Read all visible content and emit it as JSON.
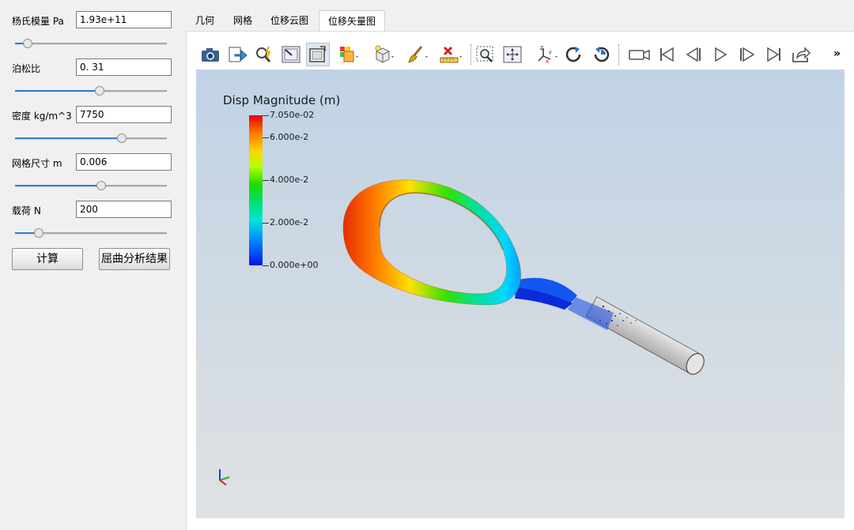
{
  "params": [
    {
      "label": "杨氏模量 Pa",
      "value": "1.93e+11",
      "slider": 0.08
    },
    {
      "label": "泊松比",
      "value": "0. 31",
      "slider": 0.55
    },
    {
      "label": "密度 kg/m^3",
      "value": "7750",
      "slider": 0.7
    },
    {
      "label": "网格尺寸 m",
      "value": "0.006",
      "slider": 0.56
    },
    {
      "label": "载荷 N",
      "value": "200",
      "slider": 0.15
    }
  ],
  "buttons": {
    "compute": "计算",
    "buckling": "屈曲分析结果"
  },
  "tabs": [
    {
      "label": "几何",
      "active": false
    },
    {
      "label": "网格",
      "active": false
    },
    {
      "label": "位移云图",
      "active": false
    },
    {
      "label": "位移矢量图",
      "active": true
    }
  ],
  "toolbar": {
    "icons": [
      "camera-icon",
      "export-icon",
      "zoom-magic-icon",
      "select-box-icon",
      "view-box-icon",
      "color-map-icon",
      "cube-icon",
      "light-icon",
      "brush-icon",
      "ruler-icon",
      "zoom-region-icon",
      "fit-view-icon",
      "axes-icon",
      "rotate-cw-icon",
      "rotate-ccw-icon",
      "video-camera-icon",
      "first-frame-icon",
      "prev-frame-icon",
      "play-icon",
      "next-frame-icon",
      "last-frame-icon",
      "share-icon"
    ],
    "more": "»"
  },
  "viewport": {
    "legend_title": "Disp Magnitude (m)",
    "legend_ticks": [
      "7.050e-02",
      "6.000e-2",
      "4.000e-2",
      "2.000e-2",
      "0.000e+00"
    ],
    "legend_fractions": [
      1.0,
      0.851,
      0.567,
      0.284,
      0.0
    ]
  }
}
